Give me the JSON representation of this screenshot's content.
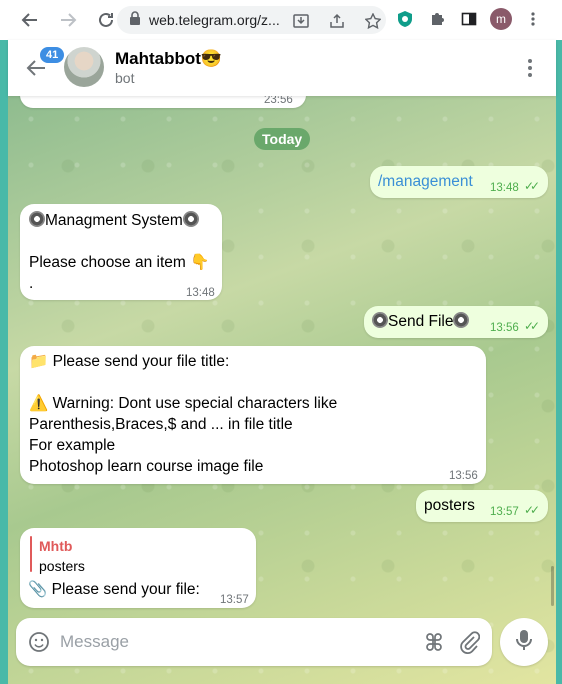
{
  "browser": {
    "url": "web.telegram.org/z...",
    "profile_initial": "m"
  },
  "header": {
    "unread_badge": "41",
    "title": "Mahtabbot😎",
    "subtitle": "bot"
  },
  "messages": {
    "top_time": "23:56",
    "date_chip": "Today",
    "m1": {
      "text": "/management",
      "time": "13:48"
    },
    "m2": {
      "line1": "Managment System",
      "line2": "Please choose an item 👇",
      "line3": ".",
      "time": "13:48"
    },
    "m3": {
      "text": "Send File",
      "time": "13:56"
    },
    "m4": {
      "line1": "Please send your file title:",
      "line2": "⚠️ Warning: Dont use special characters like",
      "line3": "Parenthesis,Braces,$ and ... in file title",
      "line4": "For example",
      "line5": "Photoshop learn course image file",
      "time": "13:56"
    },
    "m5": {
      "text": "posters",
      "time": "13:57"
    },
    "m6": {
      "reply_name": "Mhtb",
      "reply_text": "posters",
      "text": "Please send your file:",
      "time": "13:57"
    }
  },
  "composer": {
    "placeholder": "Message"
  },
  "colors": {
    "accent": "#3d8ee3",
    "outgoing_bubble": "#eeffde",
    "date_chip": "#6aa86b",
    "reply_accent": "#e05a5a"
  }
}
